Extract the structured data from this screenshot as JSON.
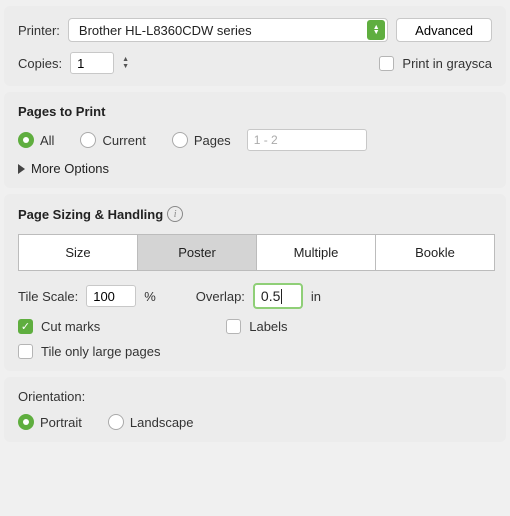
{
  "printer": {
    "label": "Printer:",
    "selected": "Brother HL-L8360CDW series",
    "advanced_label": "Advanced"
  },
  "copies": {
    "label": "Copies:",
    "value": "1",
    "grayscale_label": "Print in graysca",
    "grayscale_checked": false
  },
  "pages": {
    "heading": "Pages to Print",
    "all_label": "All",
    "current_label": "Current",
    "pages_label": "Pages",
    "pages_placeholder": "1 - 2",
    "more_label": "More Options",
    "selected": "all"
  },
  "sizing": {
    "heading": "Page Sizing & Handling",
    "tabs": {
      "size": "Size",
      "poster": "Poster",
      "multiple": "Multiple",
      "booklet": "Bookle"
    },
    "active_tab": "poster",
    "tile_scale_label": "Tile Scale:",
    "tile_scale_value": "100",
    "tile_scale_unit": "%",
    "overlap_label": "Overlap:",
    "overlap_value": "0.5",
    "overlap_unit": "in",
    "cutmarks_label": "Cut marks",
    "cutmarks_checked": true,
    "labels_label": "Labels",
    "labels_checked": false,
    "tile_only_label": "Tile only large pages",
    "tile_only_checked": false
  },
  "orientation": {
    "heading": "Orientation:",
    "portrait_label": "Portrait",
    "landscape_label": "Landscape",
    "selected": "portrait"
  }
}
